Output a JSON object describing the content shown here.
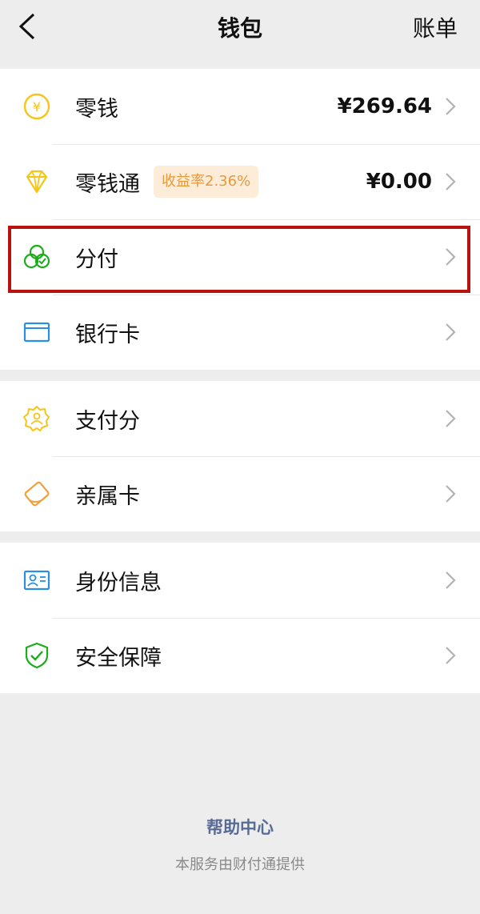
{
  "nav": {
    "title": "钱包",
    "right_label": "账单"
  },
  "group1": [
    {
      "label": "零钱",
      "value": "¥269.64",
      "icon": "coin-icon"
    },
    {
      "label": "零钱通",
      "badge": "收益率2.36%",
      "value": "¥0.00",
      "icon": "diamond-icon"
    },
    {
      "label": "分付",
      "icon": "fenfu-icon"
    },
    {
      "label": "银行卡",
      "icon": "bank-card-icon"
    }
  ],
  "group2": [
    {
      "label": "支付分",
      "icon": "pay-score-icon"
    },
    {
      "label": "亲属卡",
      "icon": "family-card-icon"
    }
  ],
  "group3": [
    {
      "label": "身份信息",
      "icon": "id-card-icon"
    },
    {
      "label": "安全保障",
      "icon": "shield-check-icon"
    }
  ],
  "footer": {
    "help_link": "帮助中心",
    "provided_by": "本服务由财付通提供"
  },
  "colors": {
    "highlight_border": "#b8120f",
    "link": "#576b95",
    "badge_bg": "#fdecd8",
    "badge_text": "#e59a3c"
  }
}
